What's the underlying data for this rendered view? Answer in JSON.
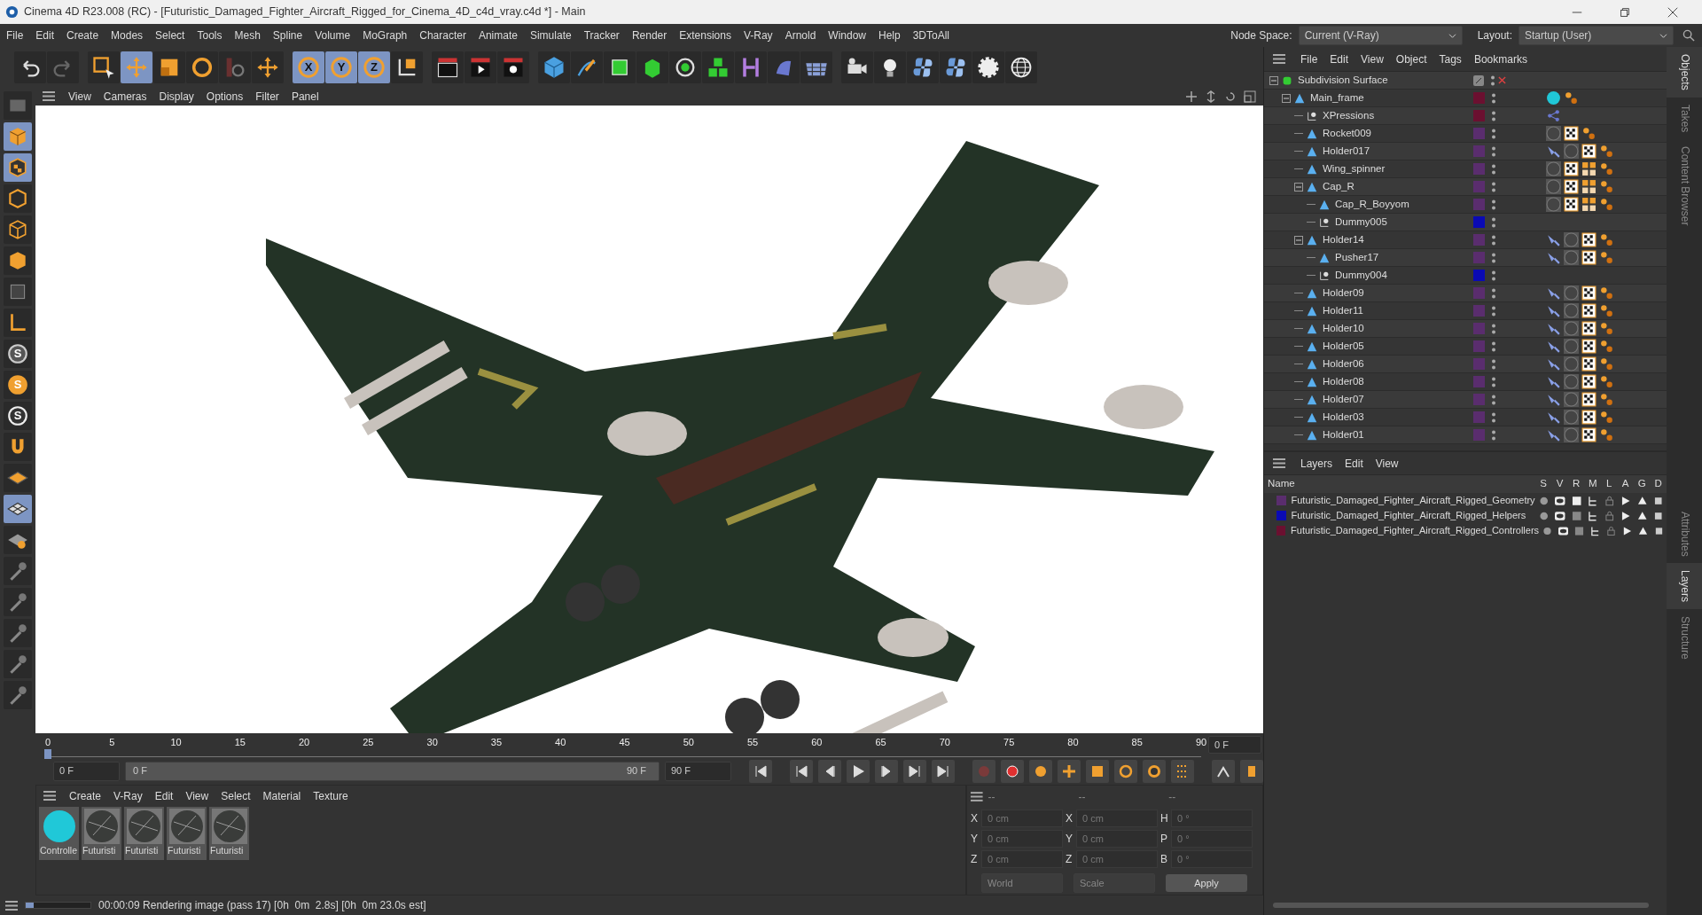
{
  "window": {
    "title": "Cinema 4D R23.008 (RC) - [Futuristic_Damaged_Fighter_Aircraft_Rigged_for_Cinema_4D_c4d_vray.c4d *] - Main"
  },
  "menu_bar": [
    "File",
    "Edit",
    "Create",
    "Modes",
    "Select",
    "Tools",
    "Mesh",
    "Spline",
    "Volume",
    "MoGraph",
    "Character",
    "Animate",
    "Simulate",
    "Tracker",
    "Render",
    "Extensions",
    "V-Ray",
    "Arnold",
    "Window",
    "Help",
    "3DToAll"
  ],
  "node_space": {
    "label": "Node Space:",
    "value": "Current (V-Ray)"
  },
  "layout": {
    "label": "Layout:",
    "value": "Startup (User)"
  },
  "toolbar": [
    {
      "kind": "undo",
      "selected": false
    },
    {
      "kind": "redo",
      "selected": false
    },
    {
      "kind": "select",
      "selected": false
    },
    {
      "kind": "move",
      "selected": true
    },
    {
      "kind": "scale",
      "selected": false
    },
    {
      "kind": "rotate",
      "selected": false
    },
    {
      "kind": "psr",
      "selected": false
    },
    {
      "kind": "move",
      "selected": false
    },
    {
      "kind": "axis",
      "label": "X",
      "selected": true
    },
    {
      "kind": "axis",
      "label": "Y",
      "selected": true
    },
    {
      "kind": "axis",
      "label": "Z",
      "selected": true
    },
    {
      "kind": "coords",
      "selected": false
    },
    {
      "kind": "render-view",
      "selected": false
    },
    {
      "kind": "render",
      "selected": false
    },
    {
      "kind": "render-settings",
      "selected": false
    },
    {
      "kind": "cube",
      "selected": false
    },
    {
      "kind": "pen",
      "selected": false
    },
    {
      "kind": "subdivision",
      "selected": false
    },
    {
      "kind": "extrude",
      "selected": false
    },
    {
      "kind": "cloner",
      "selected": false
    },
    {
      "kind": "array",
      "selected": false
    },
    {
      "kind": "bend",
      "selected": false
    },
    {
      "kind": "deformer",
      "selected": false
    },
    {
      "kind": "floor",
      "selected": false
    },
    {
      "kind": "camera",
      "selected": false
    },
    {
      "kind": "light",
      "selected": false
    },
    {
      "kind": "python",
      "selected": false
    },
    {
      "kind": "python",
      "selected": false
    },
    {
      "kind": "gear",
      "selected": false
    },
    {
      "kind": "globe",
      "selected": false
    }
  ],
  "left_toolbar": [
    {
      "kind": "viewport",
      "selected": false
    },
    {
      "kind": "model",
      "selected": true
    },
    {
      "kind": "texture",
      "selected": true
    },
    {
      "kind": "points",
      "selected": false
    },
    {
      "kind": "edges",
      "selected": false
    },
    {
      "kind": "polygons",
      "selected": false
    },
    {
      "kind": "object",
      "selected": false
    },
    {
      "kind": "axis-mode",
      "selected": false
    },
    {
      "kind": "snap",
      "label": "S",
      "selected": false
    },
    {
      "kind": "snap-orange",
      "label": "S",
      "selected": false
    },
    {
      "kind": "snap-white",
      "label": "S",
      "selected": false
    },
    {
      "kind": "magnet",
      "selected": false
    },
    {
      "kind": "grid",
      "selected": false
    },
    {
      "kind": "workplane",
      "selected": true
    },
    {
      "kind": "lock",
      "selected": false
    },
    {
      "kind": "paint",
      "selected": false
    },
    {
      "kind": "paint",
      "selected": false
    },
    {
      "kind": "paint",
      "selected": false
    },
    {
      "kind": "paint",
      "selected": false
    },
    {
      "kind": "paint",
      "selected": false
    }
  ],
  "viewport": {
    "menu": [
      "View",
      "Cameras",
      "Display",
      "Options",
      "Filter",
      "Panel"
    ]
  },
  "timeline": {
    "ticks": [
      "0",
      "5",
      "10",
      "15",
      "20",
      "25",
      "30",
      "35",
      "40",
      "45",
      "50",
      "55",
      "60",
      "65",
      "70",
      "75",
      "80",
      "85",
      "90"
    ],
    "current": "0 F",
    "start": "0 F",
    "range_start": "0 F",
    "range_end": "90 F",
    "range_level": {
      "level": 1
    },
    "end": "90 F"
  },
  "materials": {
    "menu": [
      "Create",
      "V-Ray",
      "Edit",
      "View",
      "Select",
      "Material",
      "Texture"
    ],
    "items": [
      {
        "label": "Controlle",
        "kind": "cyan"
      },
      {
        "label": "Futuristi",
        "kind": "metal"
      },
      {
        "label": "Futuristi",
        "kind": "metal"
      },
      {
        "label": "Futuristi",
        "kind": "metal"
      },
      {
        "label": "Futuristi",
        "kind": "metal"
      }
    ]
  },
  "coordinates": {
    "headers": [
      "--",
      "--",
      "--"
    ],
    "rows": [
      {
        "a": "X",
        "a_value": "0 cm",
        "b": "X",
        "b_value": "0 cm",
        "c": "H",
        "c_value": "0 °"
      },
      {
        "a": "Y",
        "a_value": "0 cm",
        "b": "Y",
        "b_value": "0 cm",
        "c": "P",
        "c_value": "0 °"
      },
      {
        "a": "Z",
        "a_value": "0 cm",
        "b": "Z",
        "b_value": "0 cm",
        "c": "B",
        "c_value": "0 °"
      }
    ],
    "mode": "World",
    "size": "Scale",
    "apply": "Apply"
  },
  "status_bar": {
    "level": 0.12,
    "text": "00:00:09 Rendering image (pass 17) [0h  0m  2.8s] [0h  0m 23.0s est]"
  },
  "objects": {
    "menu": [
      "File",
      "Edit",
      "View",
      "Object",
      "Tags",
      "Bookmarks"
    ],
    "tree": [
      {
        "name": "Subdivision Surface",
        "kind": "generator",
        "expanded": true,
        "children": [
          {
            "name": "Main_frame",
            "kind": "object",
            "color": "#6b1030",
            "tags": [
              {
                "kind": "display"
              },
              {
                "kind": "points"
              }
            ],
            "expanded": true,
            "children": [
              {
                "name": "XPressions",
                "kind": "helper",
                "color": "#6b1030",
                "tags": [
                  {
                    "kind": "xpresso"
                  }
                ]
              },
              {
                "name": "Rocket009",
                "kind": "object",
                "color": "#5a2d6e",
                "tags": [
                  {
                    "kind": "material"
                  },
                  {
                    "kind": "checker"
                  },
                  {
                    "kind": "points"
                  }
                ]
              },
              {
                "name": "Holder017",
                "kind": "object",
                "color": "#5a2d6e",
                "tags": [
                  {
                    "kind": "ik"
                  },
                  {
                    "kind": "material"
                  },
                  {
                    "kind": "checker"
                  },
                  {
                    "kind": "points"
                  }
                ]
              },
              {
                "name": "Wing_spinner",
                "kind": "object",
                "color": "#5a2d6e",
                "tags": [
                  {
                    "kind": "material"
                  },
                  {
                    "kind": "checker"
                  },
                  {
                    "kind": "uvw"
                  },
                  {
                    "kind": "points"
                  }
                ]
              },
              {
                "name": "Cap_R",
                "kind": "object",
                "color": "#5a2d6e",
                "tags": [
                  {
                    "kind": "material"
                  },
                  {
                    "kind": "checker"
                  },
                  {
                    "kind": "uvw"
                  },
                  {
                    "kind": "points"
                  }
                ],
                "expanded": true,
                "children": [
                  {
                    "name": "Cap_R_Boyyom",
                    "kind": "object",
                    "color": "#5a2d6e",
                    "tags": [
                      {
                        "kind": "material"
                      },
                      {
                        "kind": "checker"
                      },
                      {
                        "kind": "uvw"
                      },
                      {
                        "kind": "points"
                      }
                    ]
                  },
                  {
                    "name": "Dummy005",
                    "kind": "helper",
                    "color": "#0a0ab4"
                  }
                ]
              },
              {
                "name": "Holder14",
                "kind": "object",
                "color": "#5a2d6e",
                "tags": [
                  {
                    "kind": "ik"
                  },
                  {
                    "kind": "material"
                  },
                  {
                    "kind": "checker"
                  },
                  {
                    "kind": "points"
                  }
                ],
                "expanded": true,
                "children": [
                  {
                    "name": "Pusher17",
                    "kind": "object",
                    "color": "#5a2d6e",
                    "tags": [
                      {
                        "kind": "ik"
                      },
                      {
                        "kind": "material"
                      },
                      {
                        "kind": "checker"
                      },
                      {
                        "kind": "points"
                      }
                    ]
                  },
                  {
                    "name": "Dummy004",
                    "kind": "helper",
                    "color": "#0a0ab4"
                  }
                ]
              },
              {
                "name": "Holder09",
                "kind": "object",
                "color": "#5a2d6e",
                "tags": [
                  {
                    "kind": "ik"
                  },
                  {
                    "kind": "material"
                  },
                  {
                    "kind": "checker"
                  },
                  {
                    "kind": "points"
                  }
                ]
              },
              {
                "name": "Holder11",
                "kind": "object",
                "color": "#5a2d6e",
                "tags": [
                  {
                    "kind": "ik"
                  },
                  {
                    "kind": "material"
                  },
                  {
                    "kind": "checker"
                  },
                  {
                    "kind": "points"
                  }
                ]
              },
              {
                "name": "Holder10",
                "kind": "object",
                "color": "#5a2d6e",
                "tags": [
                  {
                    "kind": "ik"
                  },
                  {
                    "kind": "material"
                  },
                  {
                    "kind": "checker"
                  },
                  {
                    "kind": "points"
                  }
                ]
              },
              {
                "name": "Holder05",
                "kind": "object",
                "color": "#5a2d6e",
                "tags": [
                  {
                    "kind": "ik"
                  },
                  {
                    "kind": "material"
                  },
                  {
                    "kind": "checker"
                  },
                  {
                    "kind": "points"
                  }
                ]
              },
              {
                "name": "Holder06",
                "kind": "object",
                "color": "#5a2d6e",
                "tags": [
                  {
                    "kind": "ik"
                  },
                  {
                    "kind": "material"
                  },
                  {
                    "kind": "checker"
                  },
                  {
                    "kind": "points"
                  }
                ]
              },
              {
                "name": "Holder08",
                "kind": "object",
                "color": "#5a2d6e",
                "tags": [
                  {
                    "kind": "ik"
                  },
                  {
                    "kind": "material"
                  },
                  {
                    "kind": "checker"
                  },
                  {
                    "kind": "points"
                  }
                ]
              },
              {
                "name": "Holder07",
                "kind": "object",
                "color": "#5a2d6e",
                "tags": [
                  {
                    "kind": "ik"
                  },
                  {
                    "kind": "material"
                  },
                  {
                    "kind": "checker"
                  },
                  {
                    "kind": "points"
                  }
                ]
              },
              {
                "name": "Holder03",
                "kind": "object",
                "color": "#5a2d6e",
                "tags": [
                  {
                    "kind": "ik"
                  },
                  {
                    "kind": "material"
                  },
                  {
                    "kind": "checker"
                  },
                  {
                    "kind": "points"
                  }
                ]
              },
              {
                "name": "Holder01",
                "kind": "object",
                "color": "#5a2d6e",
                "tags": [
                  {
                    "kind": "ik"
                  },
                  {
                    "kind": "material"
                  },
                  {
                    "kind": "checker"
                  },
                  {
                    "kind": "points"
                  }
                ]
              }
            ]
          }
        ]
      }
    ]
  },
  "layers": {
    "menu": [
      "Layers",
      "Edit",
      "View"
    ],
    "columns": [
      "Name",
      "S",
      "V",
      "R",
      "M",
      "L",
      "A",
      "G",
      "D"
    ],
    "rows": [
      {
        "name": "Futuristic_Damaged_Fighter_Aircraft_Rigged_Geometry",
        "color": "#5a2d6e",
        "render": true
      },
      {
        "name": "Futuristic_Damaged_Fighter_Aircraft_Rigged_Helpers",
        "color": "#0a0ab4",
        "render": false
      },
      {
        "name": "Futuristic_Damaged_Fighter_Aircraft_Rigged_Controllers",
        "color": "#6b1030",
        "render": false
      }
    ]
  },
  "side_tabs": {
    "top": [
      {
        "label": "Objects",
        "selected": true
      },
      {
        "label": "Takes",
        "selected": false
      },
      {
        "label": "Content Browser",
        "selected": false
      }
    ],
    "bottom": [
      {
        "label": "Attributes",
        "selected": false
      },
      {
        "label": "Layers",
        "selected": true
      },
      {
        "label": "Structure",
        "selected": false
      }
    ]
  }
}
